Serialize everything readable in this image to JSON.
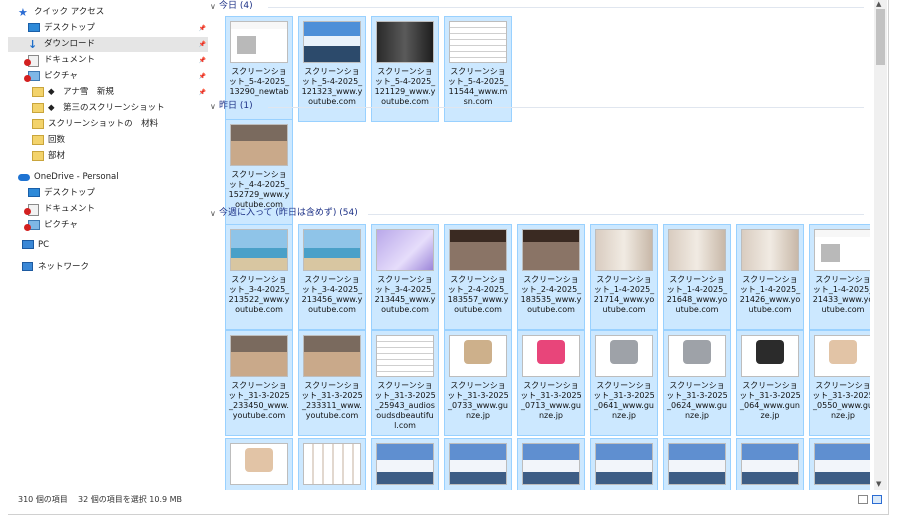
{
  "sidebar": {
    "items": [
      {
        "label": "クイック アクセス",
        "icon": "star-icon"
      },
      {
        "label": "デスクトップ",
        "icon": "desktop-icon",
        "pinned": true
      },
      {
        "label": "ダウンロード",
        "icon": "download-icon",
        "pinned": true,
        "selected": true
      },
      {
        "label": "ドキュメント",
        "icon": "documents-icon",
        "pinned": true
      },
      {
        "label": "ピクチャ",
        "icon": "pictures-icon",
        "pinned": true
      },
      {
        "label": "◆　アナ雪　新規",
        "icon": "folder-icon",
        "pinned": true
      },
      {
        "label": "◆　第三のスクリーンショット",
        "icon": "folder-icon"
      },
      {
        "label": "スクリーンショットの　材料",
        "icon": "folder-icon"
      },
      {
        "label": "回数",
        "icon": "folder-icon"
      },
      {
        "label": "部材",
        "icon": "folder-icon"
      },
      {
        "label": "OneDrive - Personal",
        "icon": "onedrive-icon"
      },
      {
        "label": "デスクトップ",
        "icon": "desktop-icon"
      },
      {
        "label": "ドキュメント",
        "icon": "documents-icon"
      },
      {
        "label": "ピクチャ",
        "icon": "pictures-icon"
      },
      {
        "label": "PC",
        "icon": "pc-icon"
      },
      {
        "label": "ネットワーク",
        "icon": "network-icon"
      }
    ]
  },
  "groups": [
    {
      "title": "今日 (4)",
      "items": [
        {
          "name": "スクリーンショット_5-4-2025_13290_newtab",
          "thumb": "web"
        },
        {
          "name": "スクリーンショット_5-4-2025_121323_www.youtube.com",
          "thumb": "mtn"
        },
        {
          "name": "スクリーンショット_5-4-2025_121129_www.youtube.com",
          "thumb": "dark"
        },
        {
          "name": "スクリーンショット_5-4-2025_11544_www.msn.com",
          "thumb": "text"
        }
      ]
    },
    {
      "title": "昨日 (1)",
      "items": [
        {
          "name": "スクリーンショット_4-4-2025_152729_www.youtube.com",
          "thumb": "road"
        }
      ]
    },
    {
      "title": "今週に入って (昨日は含めず) (54)",
      "items": [
        {
          "name": "スクリーンショット_3-4-2025_213522_www.youtube.com",
          "thumb": "beach"
        },
        {
          "name": "スクリーンショット_3-4-2025_213456_www.youtube.com",
          "thumb": "beach"
        },
        {
          "name": "スクリーンショット_3-4-2025_213445_www.youtube.com",
          "thumb": "purple"
        },
        {
          "name": "スクリーンショット_2-4-2025_183557_www.youtube.com",
          "thumb": "gym"
        },
        {
          "name": "スクリーンショット_2-4-2025_183535_www.youtube.com",
          "thumb": "gym"
        },
        {
          "name": "スクリーンショット_1-4-2025_21714_www.youtube.com",
          "thumb": "studio"
        },
        {
          "name": "スクリーンショット_1-4-2025_21648_www.youtube.com",
          "thumb": "studio"
        },
        {
          "name": "スクリーンショット_1-4-2025_21426_www.youtube.com",
          "thumb": "studio"
        },
        {
          "name": "スクリーンショット_1-4-2025_21433_www.youtube.com",
          "thumb": "web"
        },
        {
          "name": "スクリーンショット_31-3-2025_233450_www.youtube.com",
          "thumb": "road"
        },
        {
          "name": "スクリーンショット_31-3-2025_233311_www.youtube.com",
          "thumb": "road"
        },
        {
          "name": "スクリーンショット_31-3-2025_25943_audiosoudsdbeautiful.com",
          "thumb": "text"
        },
        {
          "name": "スクリーンショット_31-3-2025_0733_www.gunze.jp",
          "thumb": "tan"
        },
        {
          "name": "スクリーンショット_31-3-2025_0713_www.gunze.jp",
          "thumb": "pink"
        },
        {
          "name": "スクリーンショット_31-3-2025_0641_www.gunze.jp",
          "thumb": "grey"
        },
        {
          "name": "スクリーンショット_31-3-2025_0624_www.gunze.jp",
          "thumb": "grey"
        },
        {
          "name": "スクリーンショット_31-3-2025_064_www.gunze.jp",
          "thumb": "black"
        },
        {
          "name": "スクリーンショット_31-3-2025_0550_www.gunze.jp",
          "thumb": "skin"
        },
        {
          "name": "",
          "thumb": "skin"
        },
        {
          "name": "",
          "thumb": "grid"
        },
        {
          "name": "",
          "thumb": "snow"
        },
        {
          "name": "",
          "thumb": "snow"
        },
        {
          "name": "",
          "thumb": "snow"
        },
        {
          "name": "",
          "thumb": "snow"
        },
        {
          "name": "",
          "thumb": "snow"
        },
        {
          "name": "",
          "thumb": "snow"
        },
        {
          "name": "",
          "thumb": "snow"
        }
      ]
    }
  ],
  "status": {
    "count": "310 個の項目",
    "selected": "32 個の項目を選択  10.9 MB"
  },
  "colors": {
    "selection": "#cce8ff",
    "group_header": "#1e3287"
  }
}
